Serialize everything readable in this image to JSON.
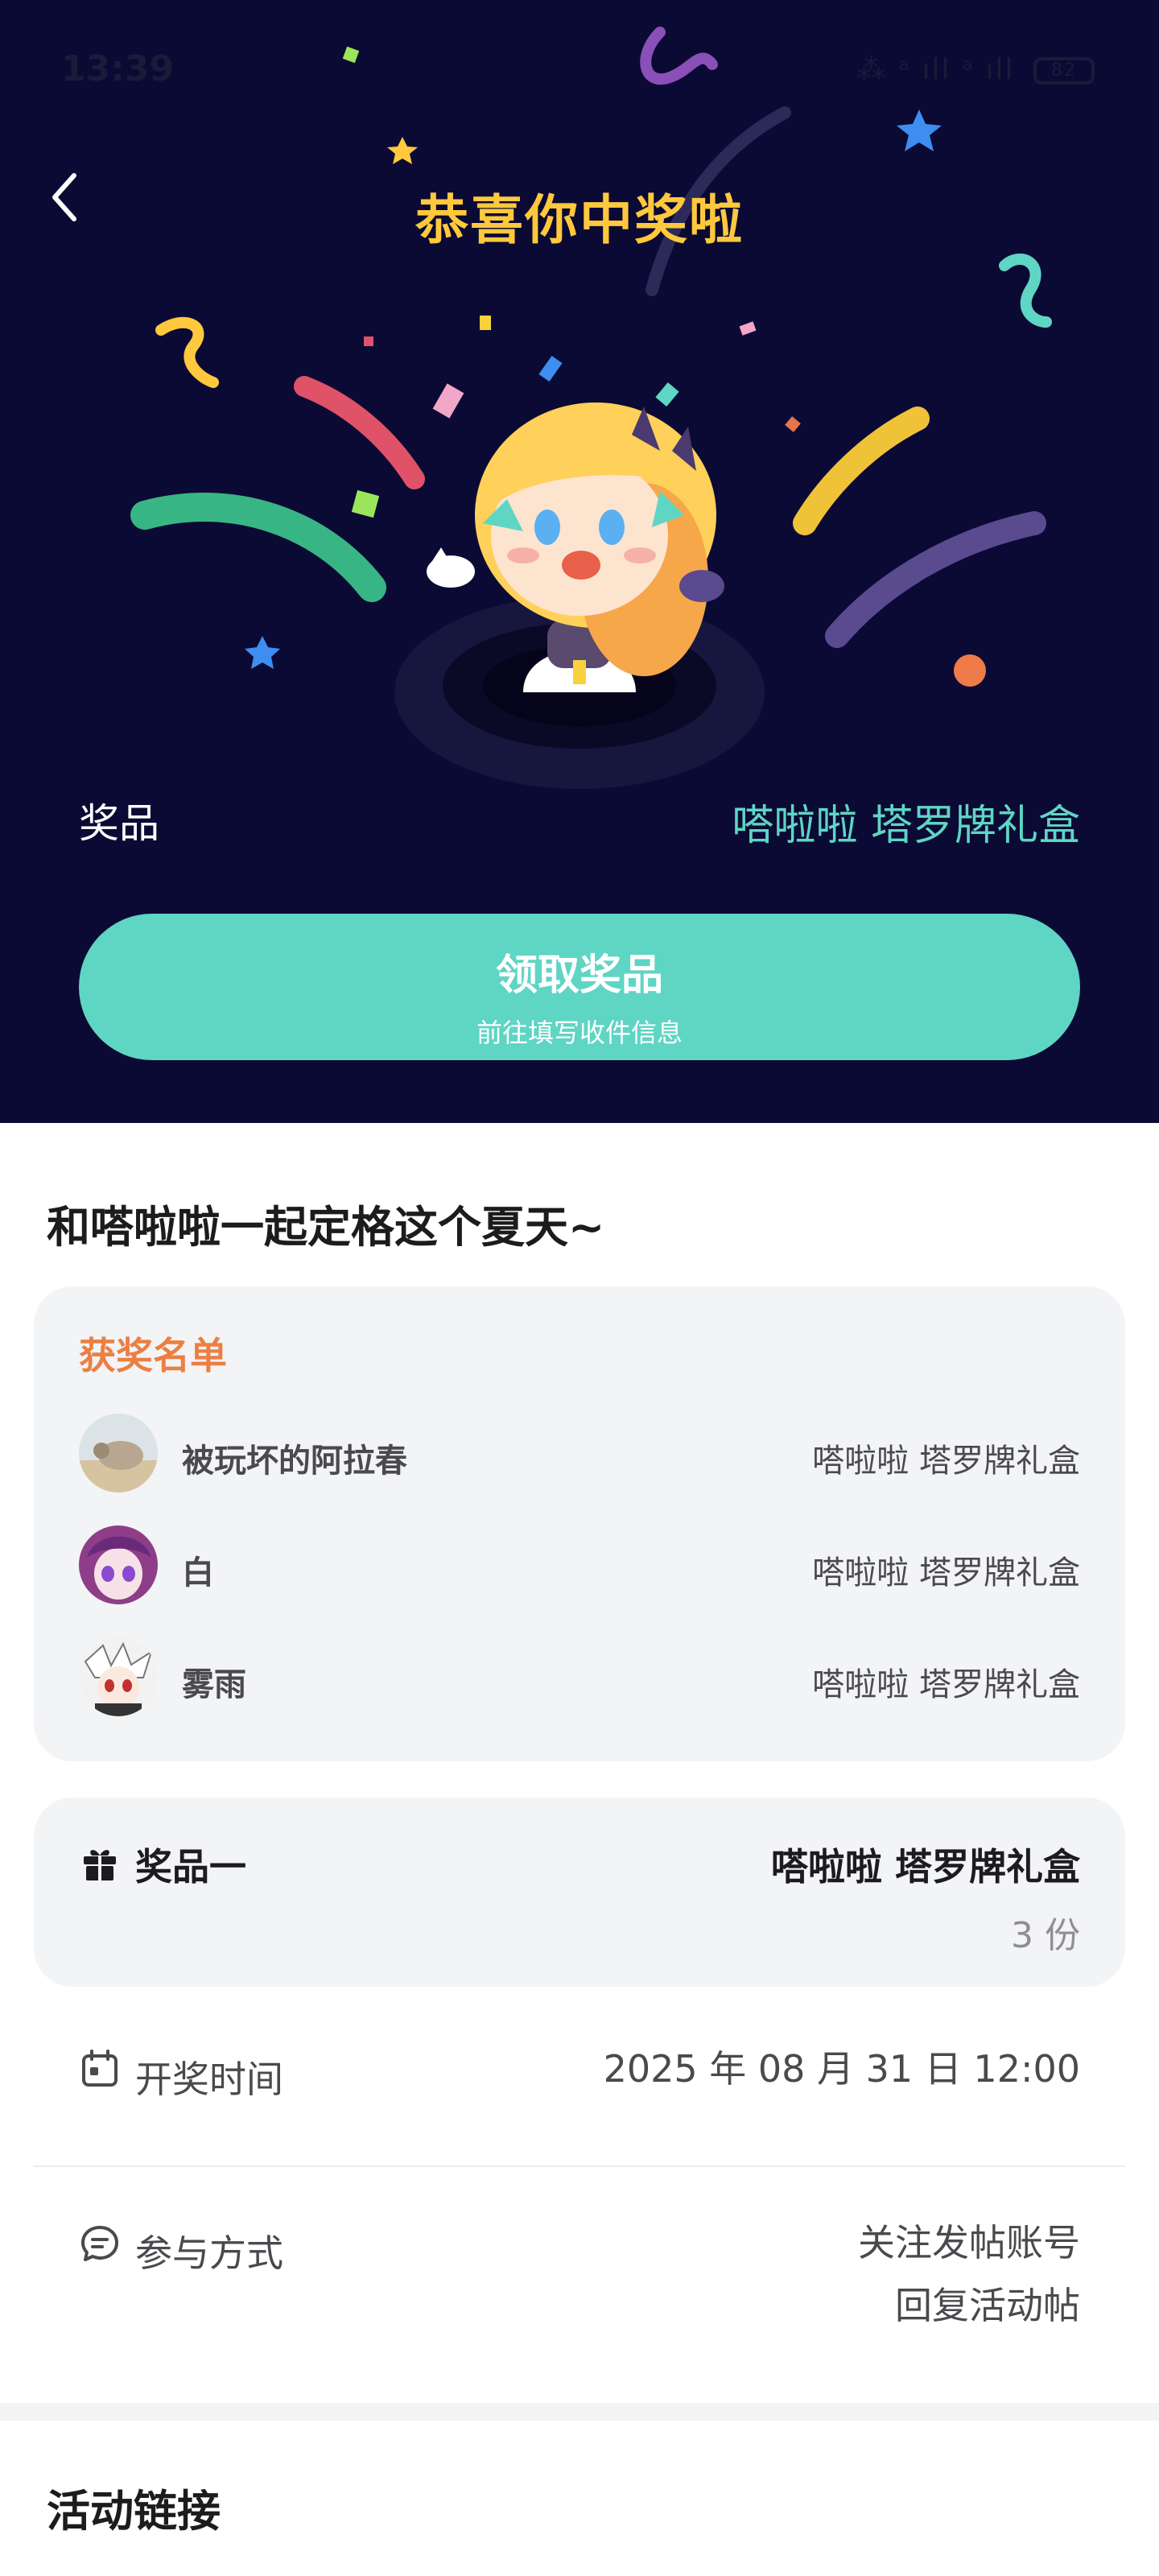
{
  "status_bar": {
    "time": "13:39",
    "icons": "⁂ ᵃ ıll ᵃ ıll",
    "battery": "82"
  },
  "hero": {
    "title": "恭喜你中奖啦",
    "prize_label": "奖品",
    "prize_value": "嗒啦啦 塔罗牌礼盒",
    "claim_button": {
      "title": "领取奖品",
      "subtitle": "前往填写收件信息"
    }
  },
  "content": {
    "section_title": "和嗒啦啦一起定格这个夏天~",
    "winners": {
      "title": "获奖名单",
      "items": [
        {
          "name": "被玩坏的阿拉春",
          "prize": "嗒啦啦 塔罗牌礼盒"
        },
        {
          "name": "白",
          "prize": "嗒啦啦 塔罗牌礼盒"
        },
        {
          "name": "雾雨",
          "prize": "嗒啦啦 塔罗牌礼盒"
        }
      ]
    },
    "prize_card": {
      "label": "奖品一",
      "name": "嗒啦啦 塔罗牌礼盒",
      "count": "3 份"
    },
    "draw_time": {
      "label": "开奖时间",
      "value": "2025 年 08 月 31 日 12:00"
    },
    "participation": {
      "label": "参与方式",
      "lines": [
        "关注发帖账号",
        "回复活动帖"
      ]
    },
    "links_title": "活动链接"
  },
  "colors": {
    "hero_bg": "#0b0a34",
    "title_gold": "#ffc83d",
    "accent_teal": "#5fd5c4",
    "winners_orange": "#ec7f43",
    "card_bg": "#f3f4f6"
  },
  "icons": [
    "back-arrow-icon",
    "gift-icon",
    "calendar-icon",
    "chat-bubble-icon"
  ]
}
